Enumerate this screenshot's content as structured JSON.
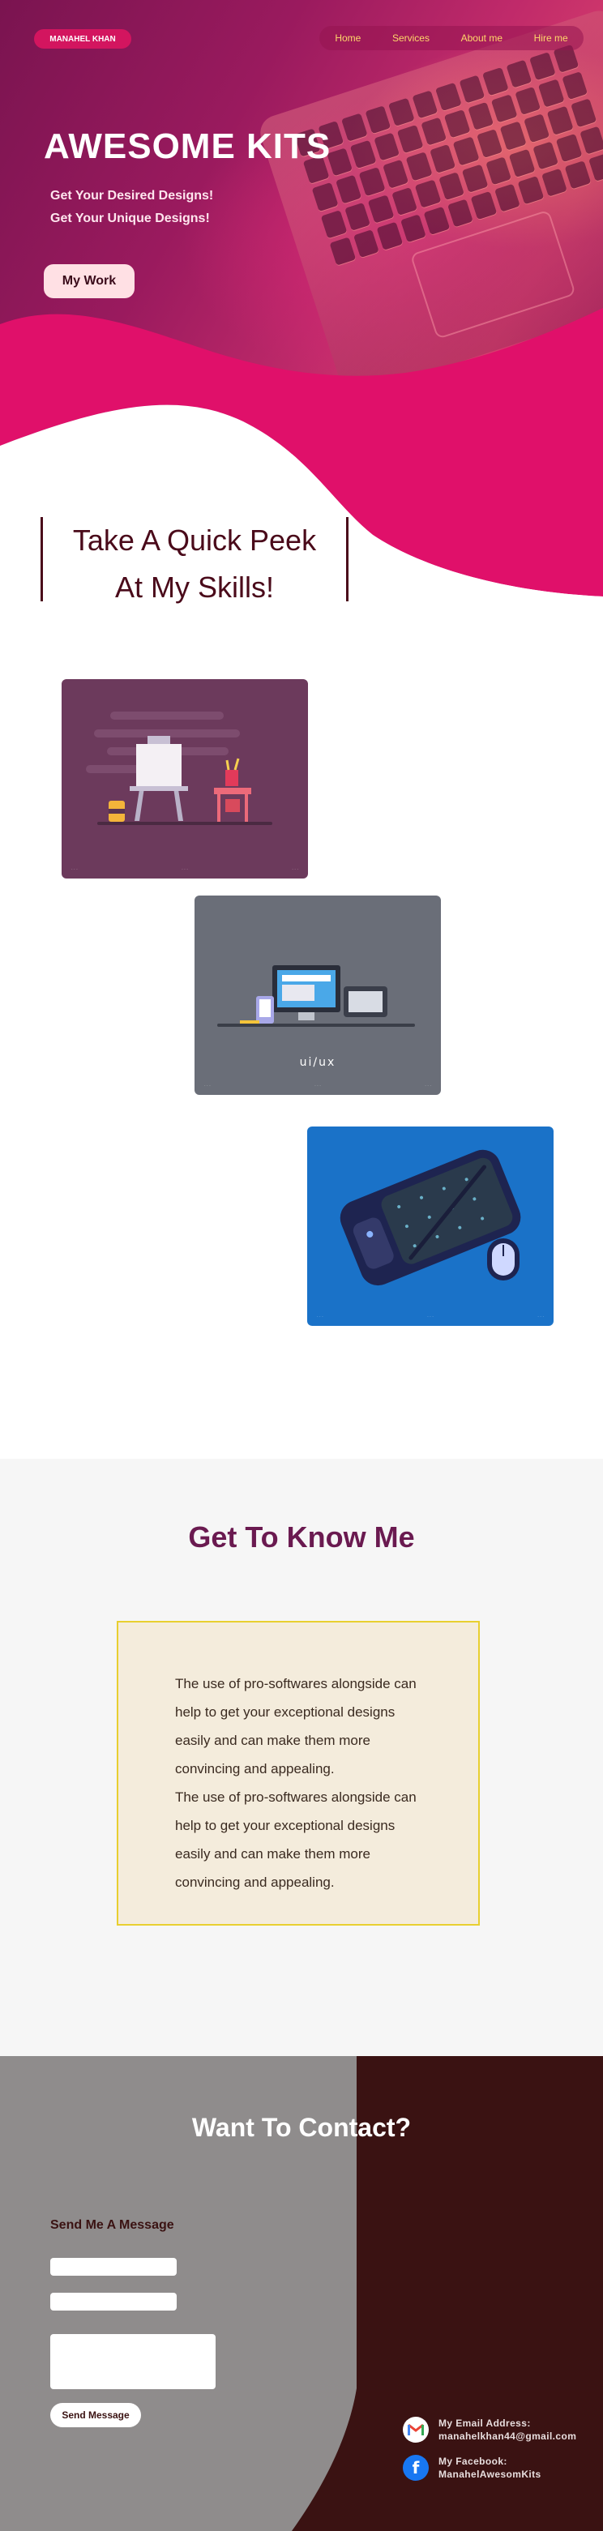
{
  "nav": {
    "brand": "MANAHEL KHAN",
    "items": [
      "Home",
      "Services",
      "About me",
      "Hire me"
    ]
  },
  "hero": {
    "title": "AWESOME KITS",
    "subtitle_1": "Get Your Desired Designs!",
    "subtitle_2": "Get Your Unique Designs!",
    "cta": "My Work"
  },
  "skills": {
    "heading_line_1": "Take A Quick Peek",
    "heading_line_2": "At My Skills!",
    "cards": [
      {
        "label": "ui/ux"
      }
    ]
  },
  "about": {
    "title": "Get To Know Me",
    "paragraph_1": "The use of pro-softwares alongside can help to get your exceptional designs easily and can make them more convincing and appealing.",
    "paragraph_2": "The use of pro-softwares alongside can help to get your exceptional designs easily and can make them more convincing and appealing."
  },
  "contact": {
    "title": "Want To Contact?",
    "message_label": "Send Me A Message",
    "send_button": "Send Message",
    "email_label": "My Email Address:",
    "email_value": "manahelkhan44@gmail.com",
    "facebook_label": "My Facebook:",
    "facebook_value": "ManahelAwesomKits"
  },
  "colors": {
    "brand_pink": "#d3155f",
    "hero_magenta": "#e0106a",
    "nav_text": "#ffd86a",
    "heading_maroon": "#4a0a1a",
    "about_purple": "#6a1a50",
    "contact_dark": "#3a1212",
    "contact_grey": "#8f8c8c"
  },
  "icons": [
    "gmail-icon",
    "facebook-icon"
  ]
}
